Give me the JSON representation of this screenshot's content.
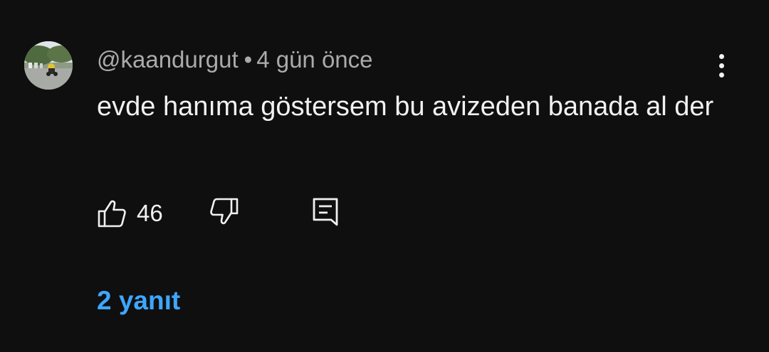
{
  "comment": {
    "author_handle": "@kaandurgut",
    "separator": "•",
    "timestamp": "4 gün önce",
    "text": "evde hanıma göstersem bu avizeden banada al der",
    "like_count": "46",
    "replies_label": "2 yanıt"
  },
  "icons": {
    "like": "thumbs-up-icon",
    "dislike": "thumbs-down-icon",
    "reply": "comment-reply-icon",
    "menu": "more-vertical-icon"
  },
  "colors": {
    "background": "#0f0f0f",
    "primary_text": "#f1f1f1",
    "secondary_text": "#aaaaaa",
    "link": "#3ea6ff"
  }
}
